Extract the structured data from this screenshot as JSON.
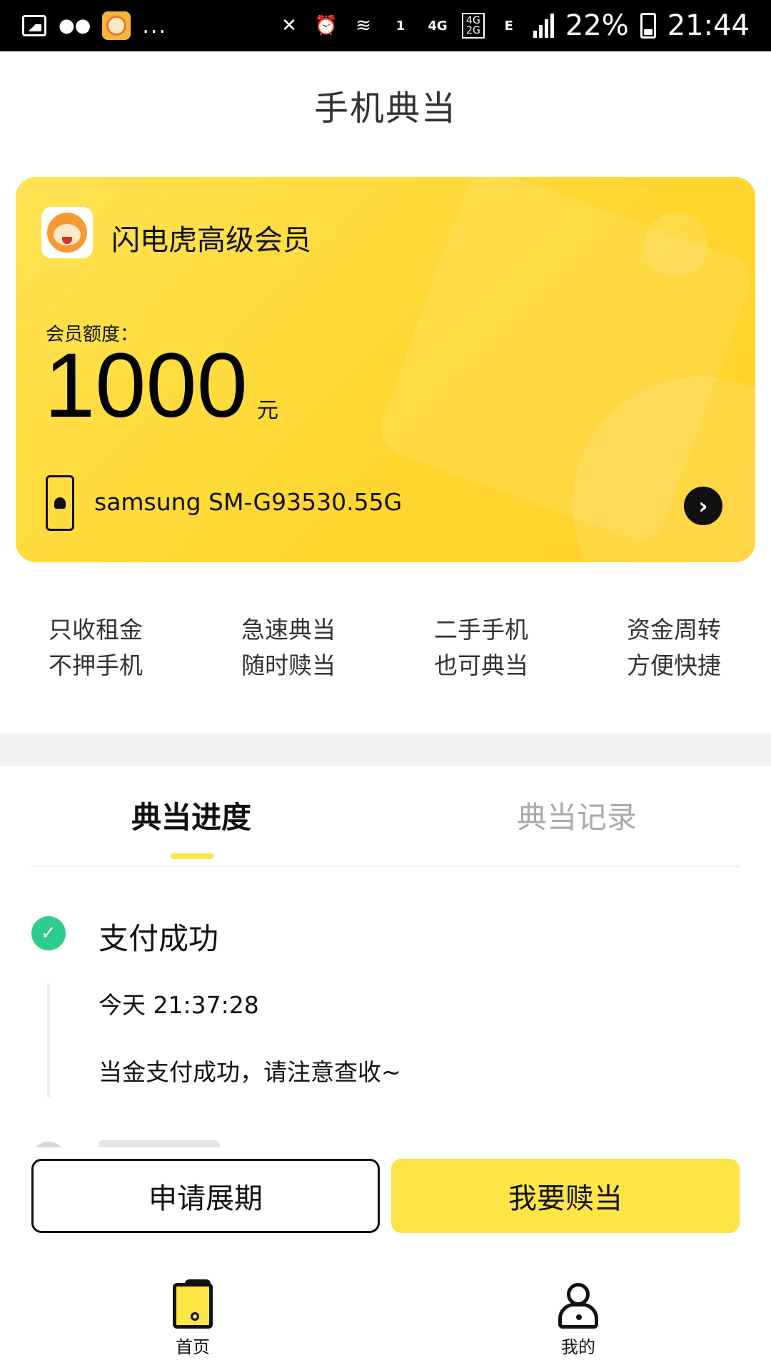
{
  "status_bar": {
    "battery": "22%",
    "time": "21:44",
    "sim_slot": "1",
    "network_a": "4G",
    "network_b_top": "4G",
    "network_b_bottom": "2G",
    "network_c": "E",
    "more": "..."
  },
  "header": {
    "title": "手机典当"
  },
  "card": {
    "title": "闪电虎高级会员",
    "quota_label": "会员额度：",
    "quota_amount": "1000",
    "quota_unit": "元",
    "device": "samsung SM-G93530.55G"
  },
  "features": [
    {
      "line1": "只收租金",
      "line2": "不押手机"
    },
    {
      "line1": "急速典当",
      "line2": "随时赎当"
    },
    {
      "line1": "二手手机",
      "line2": "也可典当"
    },
    {
      "line1": "资金周转",
      "line2": "方便快捷"
    }
  ],
  "tabs": {
    "progress": "典当进度",
    "records": "典当记录"
  },
  "progress": {
    "step_title": "支付成功",
    "time": "今天 21:37:28",
    "desc": "当金支付成功，请注意查收~"
  },
  "actions": {
    "extend": "申请展期",
    "redeem": "我要赎当"
  },
  "nav": {
    "home": "首页",
    "mine": "我的"
  },
  "colors": {
    "accent": "#fde546",
    "success": "#2ecc8b"
  },
  "icons": {
    "card_logo": "tiger-logo-icon",
    "device": "android-phone-icon",
    "arrow": "chevron-right-icon",
    "step_done": "check-icon",
    "nav_home": "phone-home-icon",
    "nav_mine": "person-icon"
  }
}
